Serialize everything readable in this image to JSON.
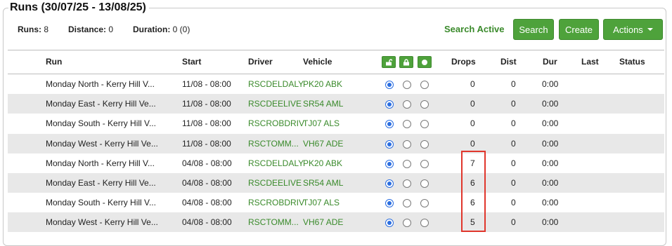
{
  "panel": {
    "title": "Runs (30/07/25 - 13/08/25)"
  },
  "stats": {
    "runs_label": "Runs:",
    "runs_value": "8",
    "distance_label": "Distance:",
    "distance_value": "0",
    "duration_label": "Duration:",
    "duration_value": "0 (0)"
  },
  "toolbar": {
    "status": "Search Active",
    "search_label": "Search",
    "create_label": "Create",
    "actions_label": "Actions"
  },
  "table": {
    "headers": {
      "run": "Run",
      "start": "Start",
      "driver": "Driver",
      "vehicle": "Vehicle",
      "drops": "Drops",
      "dist": "Dist",
      "dur": "Dur",
      "last": "Last",
      "status": "Status"
    },
    "header_icons": [
      "unlock-icon",
      "lock-icon",
      "circle-icon"
    ],
    "rows": [
      {
        "run": "Monday North - Kerry Hill V...",
        "start": "11/08 - 08:00",
        "driver": "RSCDELDALY",
        "vehicle": "PK20 ABK",
        "drops": "0",
        "dist": "0",
        "dur": "0:00",
        "last": "",
        "status": "",
        "selected": 0
      },
      {
        "run": "Monday East - Kerry Hill Ve...",
        "start": "11/08 - 08:00",
        "driver": "RSCDEELIVE",
        "vehicle": "SR54 AML",
        "drops": "0",
        "dist": "0",
        "dur": "0:00",
        "last": "",
        "status": "",
        "selected": 0
      },
      {
        "run": "Monday South - Kerry Hill V...",
        "start": "11/08 - 08:00",
        "driver": "RSCROBDRIV",
        "vehicle": "TJ07 ALS",
        "drops": "0",
        "dist": "0",
        "dur": "0:00",
        "last": "",
        "status": "",
        "selected": 0
      },
      {
        "run": "Monday West - Kerry Hill Ve...",
        "start": "11/08 - 08:00",
        "driver": "RSCTOMM...",
        "vehicle": "VH67 ADE",
        "drops": "0",
        "dist": "0",
        "dur": "0:00",
        "last": "",
        "status": "",
        "selected": 0
      },
      {
        "run": "Monday North - Kerry Hill V...",
        "start": "04/08 - 08:00",
        "driver": "RSCDELDALY",
        "vehicle": "PK20 ABK",
        "drops": "7",
        "dist": "0",
        "dur": "0:00",
        "last": "",
        "status": "",
        "selected": 0
      },
      {
        "run": "Monday East - Kerry Hill Ve...",
        "start": "04/08 - 08:00",
        "driver": "RSCDEELIVE",
        "vehicle": "SR54 AML",
        "drops": "6",
        "dist": "0",
        "dur": "0:00",
        "last": "",
        "status": "",
        "selected": 0
      },
      {
        "run": "Monday South - Kerry Hill V...",
        "start": "04/08 - 08:00",
        "driver": "RSCROBDRIV",
        "vehicle": "TJ07 ALS",
        "drops": "6",
        "dist": "0",
        "dur": "0:00",
        "last": "",
        "status": "",
        "selected": 0
      },
      {
        "run": "Monday West - Kerry Hill Ve...",
        "start": "04/08 - 08:00",
        "driver": "RSCTOMM...",
        "vehicle": "VH67 ADE",
        "drops": "5",
        "dist": "0",
        "dur": "0:00",
        "last": "",
        "status": "",
        "selected": 0
      }
    ]
  },
  "colors": {
    "accent": "#4ea23b",
    "link": "#3a8a2b",
    "highlight": "#e0362c",
    "radio": "#2a6de0"
  }
}
